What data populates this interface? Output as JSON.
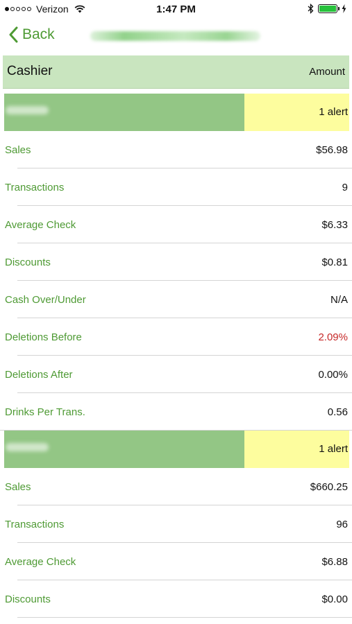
{
  "status_bar": {
    "carrier": "Verizon",
    "signal_bars_filled": 1,
    "signal_bars_total": 5,
    "time": "1:47 PM",
    "battery_level": 1.0,
    "icons": [
      "wifi-icon",
      "bluetooth-icon",
      "battery-icon",
      "charging-icon"
    ]
  },
  "nav": {
    "back_label": "Back"
  },
  "table_header": {
    "col_name": "Cashier",
    "col_amount": "Amount"
  },
  "colors": {
    "accent_green": "#4e9a34",
    "section_green": "#93c685",
    "header_green": "#c9e5bf",
    "alert_yellow": "#fdfd9e",
    "alert_red": "#c62828"
  },
  "sections": [
    {
      "alert_text": "1 alert",
      "rows": [
        {
          "label": "Sales",
          "value": "$56.98"
        },
        {
          "label": "Transactions",
          "value": "9"
        },
        {
          "label": "Average Check",
          "value": "$6.33"
        },
        {
          "label": "Discounts",
          "value": "$0.81"
        },
        {
          "label": "Cash Over/Under",
          "value": "N/A"
        },
        {
          "label": "Deletions Before",
          "value": "2.09%",
          "alert": true
        },
        {
          "label": "Deletions After",
          "value": "0.00%"
        },
        {
          "label": "Drinks Per Trans.",
          "value": "0.56"
        }
      ]
    },
    {
      "alert_text": "1 alert",
      "rows": [
        {
          "label": "Sales",
          "value": "$660.25"
        },
        {
          "label": "Transactions",
          "value": "96"
        },
        {
          "label": "Average Check",
          "value": "$6.88"
        },
        {
          "label": "Discounts",
          "value": "$0.00"
        }
      ]
    }
  ]
}
